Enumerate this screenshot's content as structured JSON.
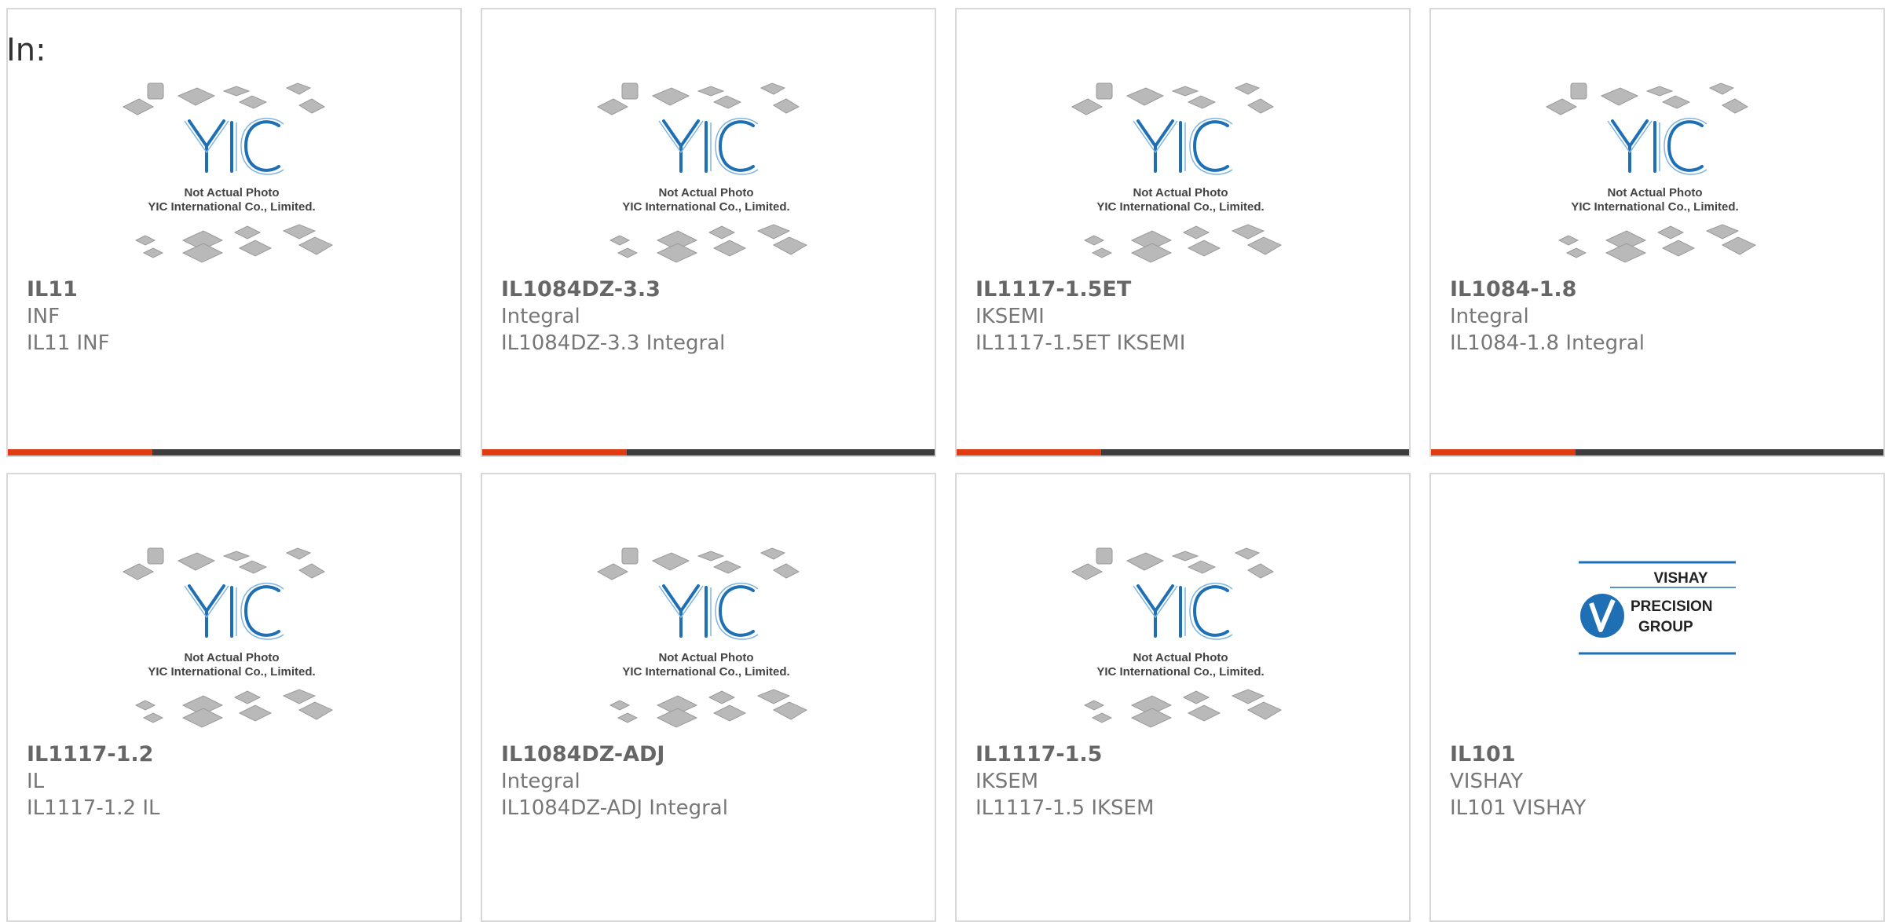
{
  "page": {
    "label": "In:"
  },
  "colors": {
    "accent": "#e03c12",
    "bar": "#3d3d3d",
    "border": "#d8d8d8",
    "text": "#777777",
    "logo_blue": "#1f6fb5"
  },
  "placeholder_image": {
    "line1": "Not Actual Photo",
    "line2": "YIC International Co., Limited.",
    "logo_text": "YIC"
  },
  "vishay_logo": {
    "line1": "VISHAY",
    "line2": "PRECISION",
    "line3": "GROUP"
  },
  "products": [
    {
      "part": "IL11",
      "manufacturer": "INF",
      "description": "IL11 INF",
      "image": "yic-placeholder",
      "accent_bar": true
    },
    {
      "part": "IL1084DZ-3.3",
      "manufacturer": "Integral",
      "description": "IL1084DZ-3.3 Integral",
      "image": "yic-placeholder",
      "accent_bar": true
    },
    {
      "part": "IL1117-1.5ET",
      "manufacturer": "IKSEMI",
      "description": "IL1117-1.5ET IKSEMI",
      "image": "yic-placeholder",
      "accent_bar": true
    },
    {
      "part": "IL1084-1.8",
      "manufacturer": "Integral",
      "description": "IL1084-1.8 Integral",
      "image": "yic-placeholder",
      "accent_bar": true
    },
    {
      "part": "IL1117-1.2",
      "manufacturer": "IL",
      "description": "IL1117-1.2 IL",
      "image": "yic-placeholder",
      "accent_bar": false
    },
    {
      "part": "IL1084DZ-ADJ",
      "manufacturer": "Integral",
      "description": "IL1084DZ-ADJ Integral",
      "image": "yic-placeholder",
      "accent_bar": false
    },
    {
      "part": "IL1117-1.5",
      "manufacturer": "IKSEM",
      "description": "IL1117-1.5 IKSEM",
      "image": "yic-placeholder",
      "accent_bar": false
    },
    {
      "part": "IL101",
      "manufacturer": "VISHAY",
      "description": "IL101 VISHAY",
      "image": "vishay-precision-logo",
      "accent_bar": false
    }
  ]
}
